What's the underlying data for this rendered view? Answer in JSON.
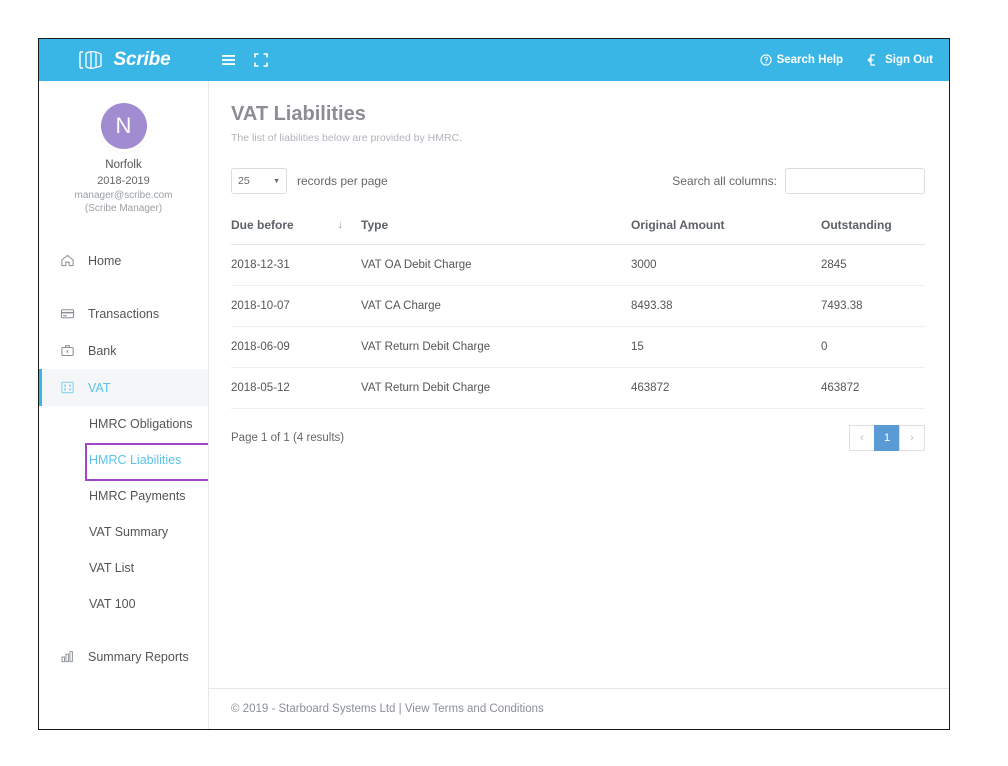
{
  "header": {
    "brand": "Scribe",
    "brand_logo_icon": "book-logo-icon",
    "menu_toggle_icon": "hamburger-menu-icon",
    "fullscreen_icon": "fullscreen-expand-icon",
    "search_help_label": "Search Help",
    "search_help_icon": "question-circle-icon",
    "sign_out_label": "Sign Out",
    "sign_out_icon": "sign-out-icon",
    "background_color": "#39b6e6"
  },
  "sidebar": {
    "profile": {
      "avatar_initial": "N",
      "avatar_color": "#a18bd1",
      "name": "Norfolk",
      "period": "2018-2019",
      "email": "manager@scribe.com",
      "role": "(Scribe Manager)"
    },
    "nav": [
      {
        "label": "Home",
        "icon": "home-icon",
        "active": false
      },
      {
        "label": "Transactions",
        "icon": "card-icon",
        "active": false
      },
      {
        "label": "Bank",
        "icon": "briefcase-icon",
        "active": false
      },
      {
        "label": "VAT",
        "icon": "calculator-grid-icon",
        "active": true
      }
    ],
    "subnav": [
      {
        "label": "HMRC Obligations",
        "active": false,
        "annotated": false
      },
      {
        "label": "HMRC Liabilities",
        "active": true,
        "annotated": true
      },
      {
        "label": "HMRC Payments",
        "active": false,
        "annotated": false
      },
      {
        "label": "VAT Summary",
        "active": false,
        "annotated": false
      },
      {
        "label": "VAT List",
        "active": false,
        "annotated": false
      },
      {
        "label": "VAT 100",
        "active": false,
        "annotated": false
      }
    ],
    "bottom_nav": [
      {
        "label": "Summary Reports",
        "icon": "bar-chart-icon",
        "active": false
      }
    ],
    "active_color": "#5bc2ea",
    "annotation_color": "#a347c9"
  },
  "main": {
    "title": "VAT Liabilities",
    "subtitle": "The list of liabilities below are provided by HMRC.",
    "controls": {
      "records_per_page_value": "25",
      "records_per_page_label": "records per page",
      "caret_icon": "chevron-down-icon",
      "search_label": "Search all columns:",
      "search_value": "",
      "search_placeholder": ""
    },
    "table": {
      "columns": [
        "Due before",
        "Type",
        "Original Amount",
        "Outstanding"
      ],
      "sort_column": "Due before",
      "sort_icon": "sort-down-arrow-icon",
      "rows": [
        {
          "due_before": "2018-12-31",
          "type": "VAT OA Debit Charge",
          "original_amount": "3000",
          "outstanding": "2845"
        },
        {
          "due_before": "2018-10-07",
          "type": "VAT CA Charge",
          "original_amount": "8493.38",
          "outstanding": "7493.38"
        },
        {
          "due_before": "2018-06-09",
          "type": "VAT Return Debit Charge",
          "original_amount": "15",
          "outstanding": "0"
        },
        {
          "due_before": "2018-05-12",
          "type": "VAT Return Debit Charge",
          "original_amount": "463872",
          "outstanding": "463872"
        }
      ]
    },
    "pagination": {
      "info": "Page 1 of 1 (4 results)",
      "prev_icon": "chevron-left-icon",
      "next_icon": "chevron-right-icon",
      "pages": [
        "1"
      ],
      "current_page": "1",
      "active_color": "#5b9bd5"
    }
  },
  "footer": {
    "copyright": "© 2019 - Starboard Systems Ltd | ",
    "terms_link": "View Terms and Conditions"
  }
}
